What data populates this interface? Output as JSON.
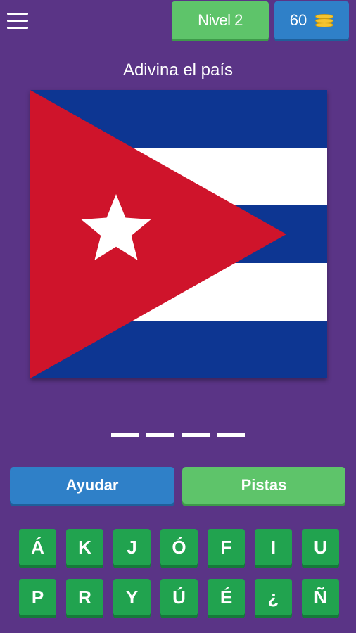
{
  "header": {
    "level_label": "Nivel 2",
    "coins": "60",
    "coin_icon": "coin-stack-icon",
    "menu_icon": "hamburger-menu-icon"
  },
  "prompt": "Adivina el país",
  "flag": {
    "country_icon": "flag-image",
    "colors": {
      "blue": "#0d3692",
      "white": "#ffffff",
      "red": "#cf142b"
    }
  },
  "answer": {
    "slot_count": 4,
    "filled": [
      "",
      "",
      "",
      ""
    ]
  },
  "buttons": {
    "help": "Ayudar",
    "hints": "Pistas"
  },
  "keyboard": {
    "row1": [
      "Á",
      "K",
      "J",
      "Ó",
      "F",
      "I",
      "U"
    ],
    "row2": [
      "P",
      "R",
      "Y",
      "Ú",
      "É",
      "¿",
      "Ñ"
    ]
  },
  "colors": {
    "background": "#5a3486",
    "level_badge": "#5ec46a",
    "coins_badge": "#2f80c8",
    "help_button": "#2f80c8",
    "hints_button": "#5ec46a",
    "key": "#21a34f"
  }
}
